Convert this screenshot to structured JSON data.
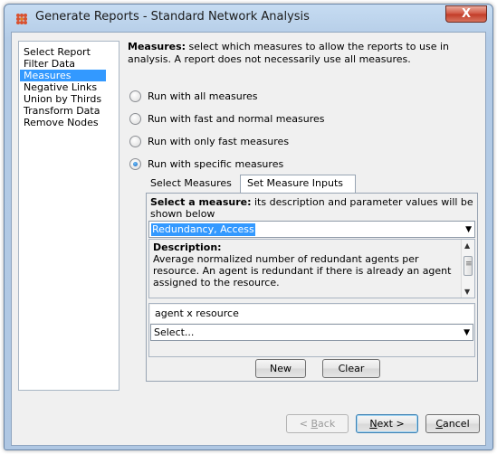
{
  "window": {
    "title": "Generate Reports - Standard Network Analysis",
    "close_label": "X"
  },
  "nav": {
    "items": [
      {
        "label": "Select Report",
        "active": false
      },
      {
        "label": "Filter Data",
        "active": false
      },
      {
        "label": "Measures",
        "active": true
      },
      {
        "label": "Negative Links",
        "active": false
      },
      {
        "label": "Union by Thirds",
        "active": false
      },
      {
        "label": "Transform Data",
        "active": false
      },
      {
        "label": "Remove Nodes",
        "active": false
      }
    ]
  },
  "measures": {
    "heading": "Measures:",
    "intro": "select which measures to allow the reports to use in analysis. A report does not necessarily use all measures.",
    "options": [
      {
        "label": "Run with all measures",
        "selected": false
      },
      {
        "label": "Run with fast and normal measures",
        "selected": false
      },
      {
        "label": "Run with only fast measures",
        "selected": false
      },
      {
        "label": "Run with specific measures",
        "selected": true
      }
    ]
  },
  "tabs": [
    {
      "label": "Select Measures",
      "active": false
    },
    {
      "label": "Set Measure Inputs",
      "active": true
    }
  ],
  "panel": {
    "select_heading": "Select a measure:",
    "select_text": "its description and parameter values will be shown below",
    "measure_value": "Redundancy, Access",
    "description_heading": "Description:",
    "description_text": "Average normalized number of redundant agents per resource. An agent is redundant if there is already an agent assigned to the resource.",
    "parameter_name": "agent x resource",
    "parameter_value": "Select...",
    "new_label": "New",
    "clear_label": "Clear"
  },
  "footer": {
    "back_prefix": "< ",
    "back_accel": "B",
    "back_rest": "ack",
    "next_accel": "N",
    "next_rest": "ext >",
    "cancel_accel": "C",
    "cancel_rest": "ancel"
  },
  "colors": {
    "selection": "#3399ff",
    "titlebar": "#c6dcf2",
    "close_button": "#c13b26"
  }
}
